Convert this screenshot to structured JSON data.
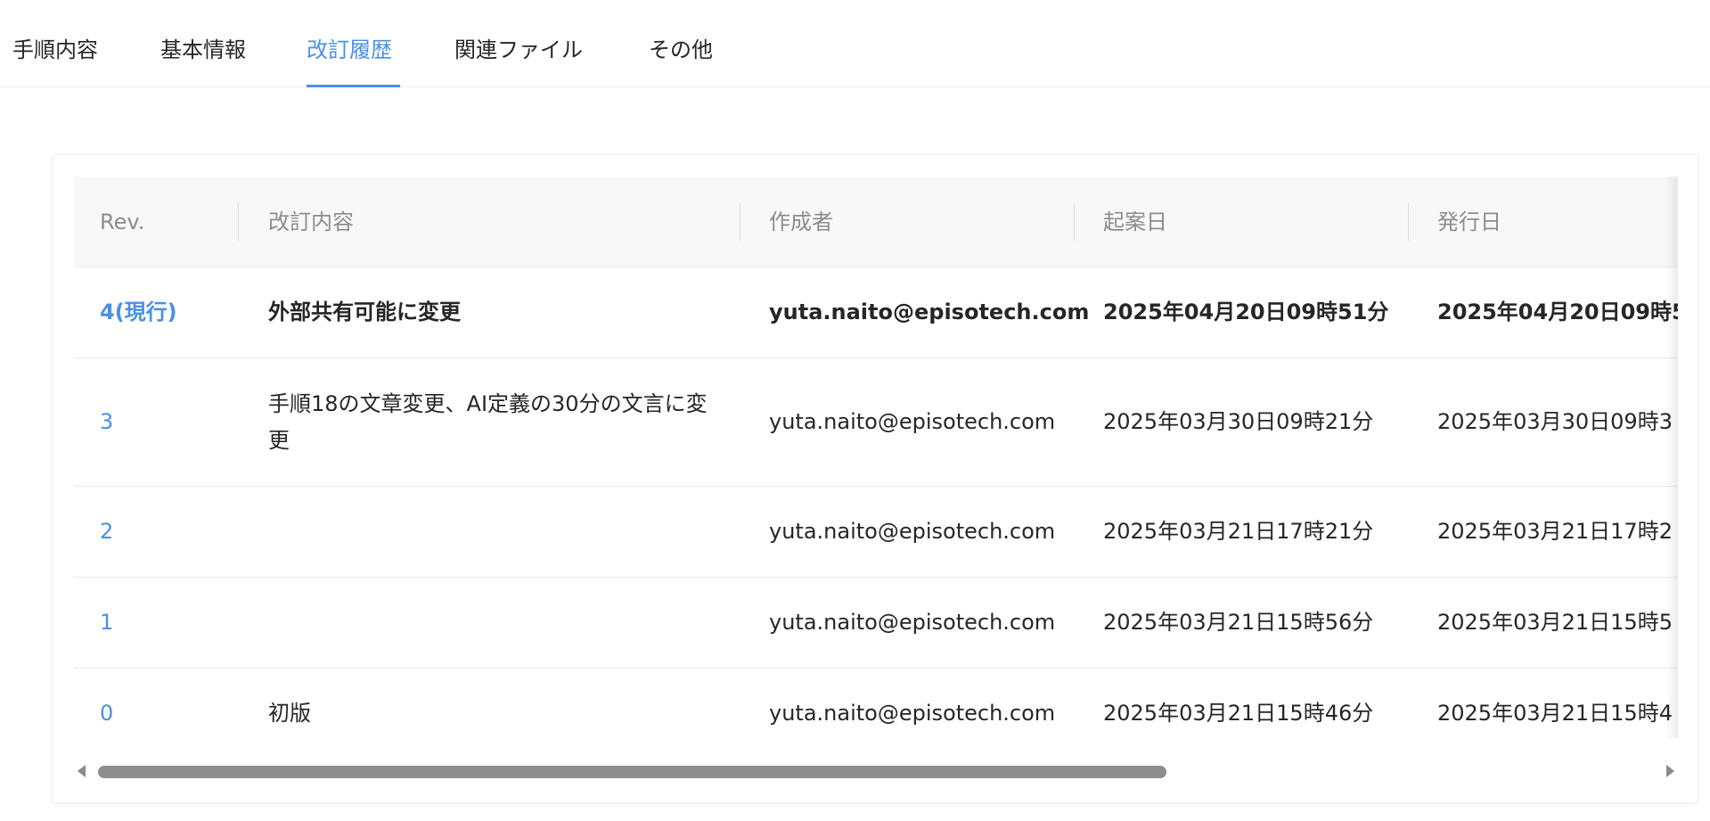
{
  "tabs": [
    {
      "label": "手順内容"
    },
    {
      "label": "基本情報"
    },
    {
      "label": "改訂履歴"
    },
    {
      "label": "関連ファイル"
    },
    {
      "label": "その他"
    }
  ],
  "active_tab": "改訂履歴",
  "table": {
    "headers": {
      "rev": "Rev.",
      "content": "改訂内容",
      "author": "作成者",
      "draft_date": "起案日",
      "issue_date": "発行日"
    },
    "rows": [
      {
        "rev": "4(現行)",
        "content": "外部共有可能に変更",
        "author": "yuta.naito@episotech.com",
        "draft_date": "2025年04月20日09時51分",
        "issue_date": "2025年04月20日09時5"
      },
      {
        "rev": "3",
        "content": "手順18の文章変更、AI定義の30分の文言に変更",
        "author": "yuta.naito@episotech.com",
        "draft_date": "2025年03月30日09時21分",
        "issue_date": "2025年03月30日09時3"
      },
      {
        "rev": "2",
        "content": "",
        "author": "yuta.naito@episotech.com",
        "draft_date": "2025年03月21日17時21分",
        "issue_date": "2025年03月21日17時2"
      },
      {
        "rev": "1",
        "content": "",
        "author": "yuta.naito@episotech.com",
        "draft_date": "2025年03月21日15時56分",
        "issue_date": "2025年03月21日15時5"
      },
      {
        "rev": "0",
        "content": "初版",
        "author": "yuta.naito@episotech.com",
        "draft_date": "2025年03月21日15時46分",
        "issue_date": "2025年03月21日15時4"
      }
    ]
  },
  "colors": {
    "accent": "#4a90e2",
    "header_text": "#8c8c8c",
    "body_text": "#262626"
  },
  "icons": {
    "scroll_left": "caret-left-icon",
    "scroll_right": "caret-right-icon"
  }
}
